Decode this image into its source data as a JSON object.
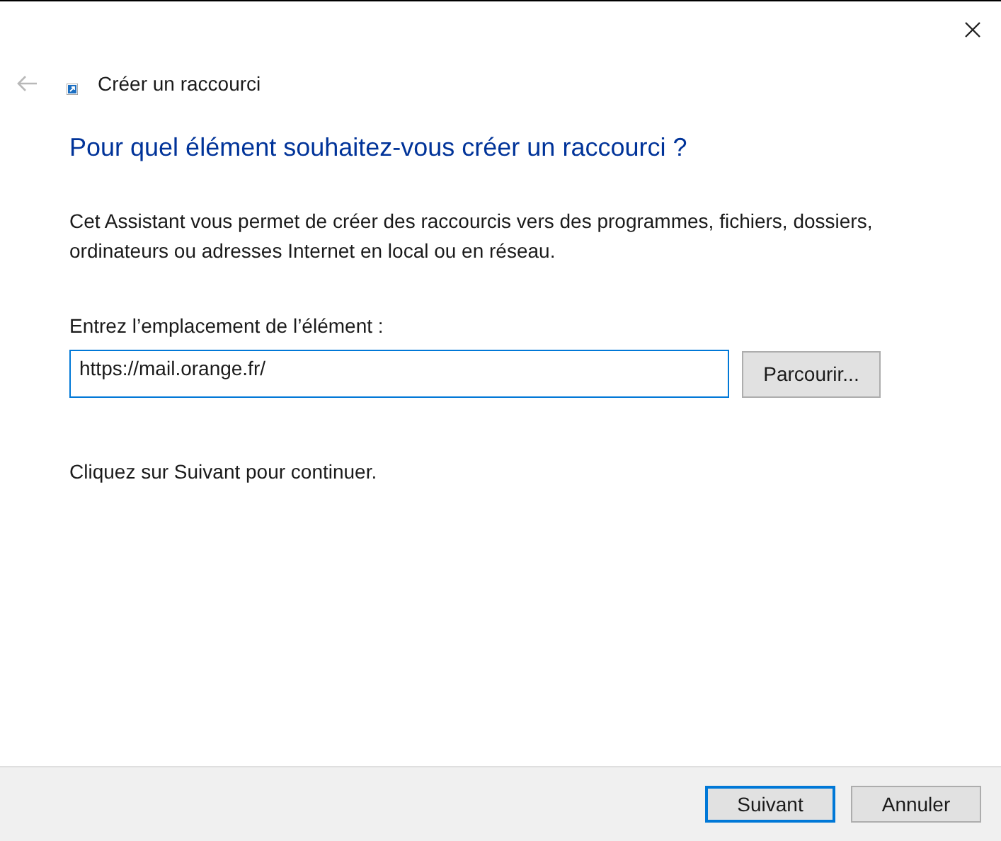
{
  "window": {
    "title": "Créer un raccourci",
    "back_disabled": true
  },
  "heading": "Pour quel élément souhaitez-vous créer un raccourci ?",
  "description": "Cet Assistant vous permet de créer des raccourcis vers des programmes, fichiers, dossiers, ordinateurs ou adresses Internet en local ou en réseau.",
  "location": {
    "label": "Entrez l’emplacement de l’élément :",
    "value": "https://mail.orange.fr/",
    "browse_button": "Parcourir..."
  },
  "hint": "Cliquez sur Suivant pour continuer.",
  "buttons": [
    {
      "label": "Suivant",
      "default": true
    },
    {
      "label": "Annuler",
      "default": false
    }
  ]
}
